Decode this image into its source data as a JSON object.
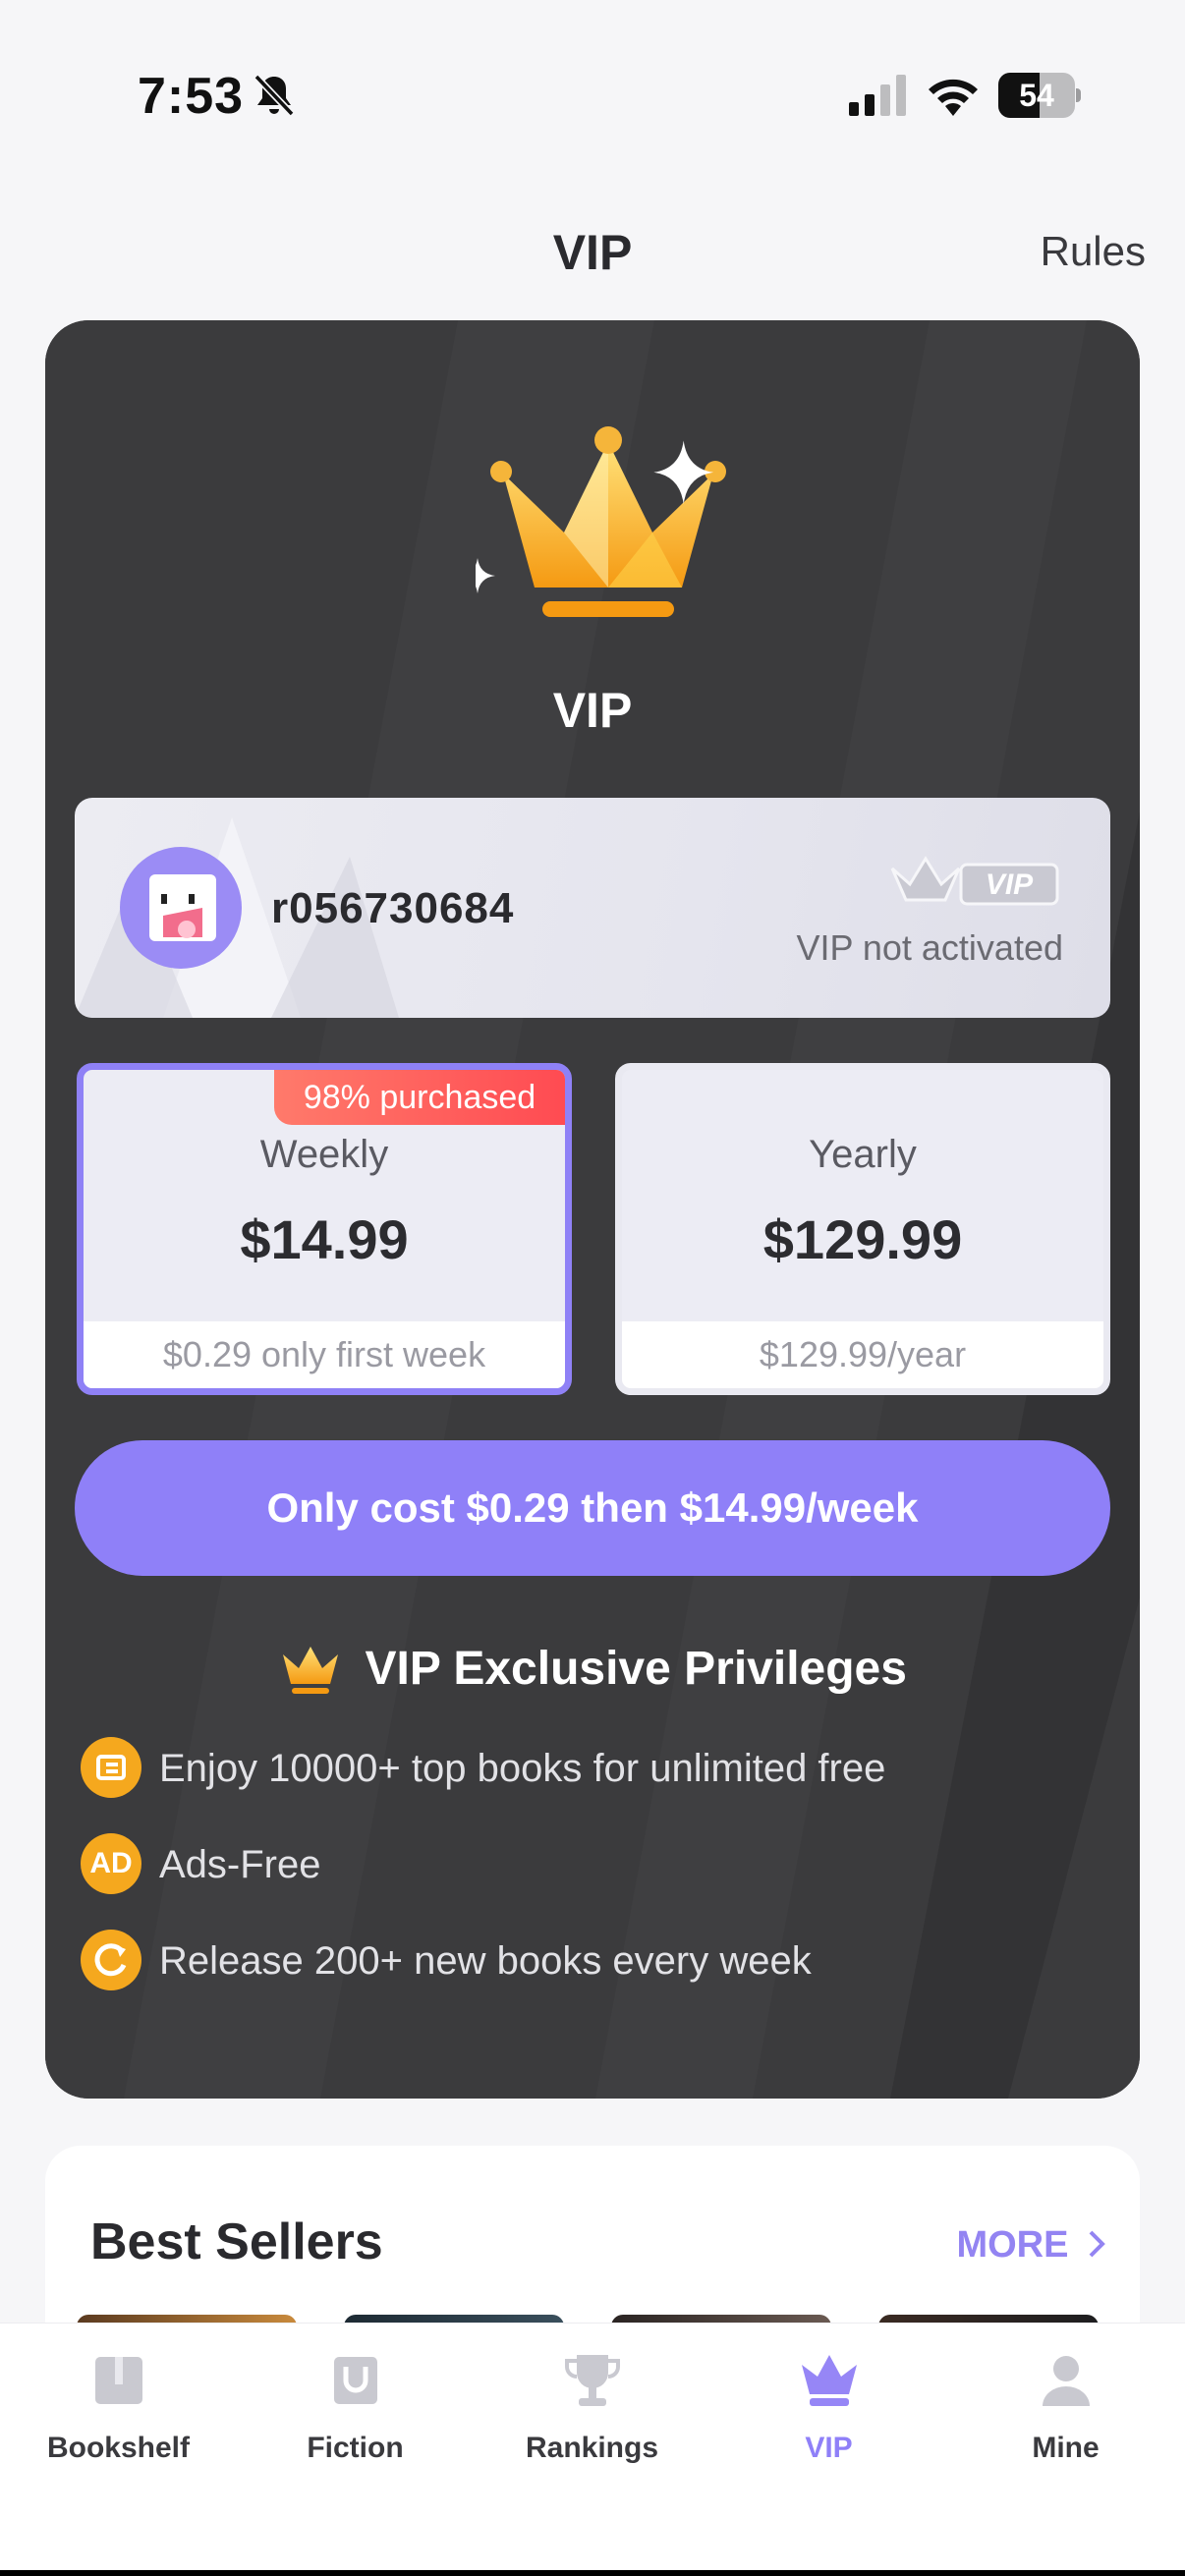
{
  "status_bar": {
    "time": "7:53",
    "battery_level": "54",
    "battery_fraction": 0.54
  },
  "header": {
    "title": "VIP",
    "rules_label": "Rules"
  },
  "vip_panel": {
    "title": "VIP",
    "user": {
      "username": "r056730684",
      "vip_badge": "VIP",
      "status": "VIP not activated"
    },
    "plans": [
      {
        "name": "Weekly",
        "price": "$14.99",
        "note": "$0.29 only first week",
        "tag": "98% purchased",
        "selected": true
      },
      {
        "name": "Yearly",
        "price": "$129.99",
        "note": "$129.99/year",
        "selected": false
      }
    ],
    "cta_label": "Only cost $0.29 then $14.99/week",
    "privileges_title": "VIP Exclusive Privileges",
    "privileges": [
      {
        "icon": "books-icon",
        "text": "Enjoy 10000+ top books for unlimited free"
      },
      {
        "icon": "ad-icon",
        "icon_text": "AD",
        "text": "Ads-Free"
      },
      {
        "icon": "refresh-icon",
        "text": "Release 200+ new books every week"
      }
    ]
  },
  "best_sellers": {
    "title": "Best Sellers",
    "more_label": "MORE"
  },
  "tabs": [
    {
      "label": "Bookshelf",
      "icon": "bookshelf-icon",
      "active": false
    },
    {
      "label": "Fiction",
      "icon": "fiction-icon",
      "active": false
    },
    {
      "label": "Rankings",
      "icon": "trophy-icon",
      "active": false
    },
    {
      "label": "VIP",
      "icon": "crown-icon",
      "active": true
    },
    {
      "label": "Mine",
      "icon": "person-icon",
      "active": false
    }
  ],
  "colors": {
    "accent": "#8f80f8",
    "panel_bg": "#3a3a3c",
    "gold": "#f5a81e",
    "tag_red": "#ff4b52"
  }
}
